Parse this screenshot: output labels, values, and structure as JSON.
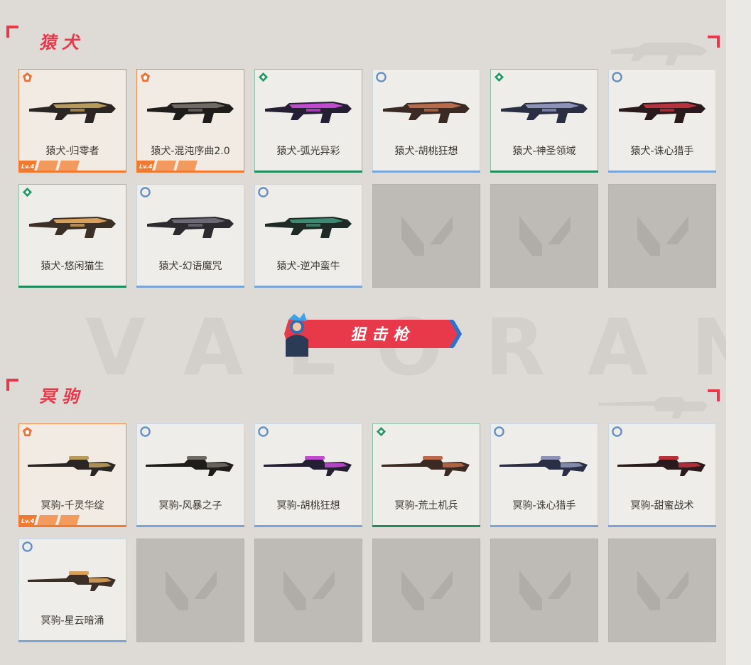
{
  "watermark": "VALORANT",
  "colors": {
    "accent": "#e8394a",
    "orange": "#f07a30",
    "green": "#1f8a5b",
    "blue": "#7aa4d6"
  },
  "sections": [
    {
      "title": "猿犬",
      "items": [
        {
          "name": "猿犬-归零者",
          "rarity": "exclusive",
          "badge": "pentagon-icon",
          "level": "Lv.4"
        },
        {
          "name": "猿犬-混沌序曲2.0",
          "rarity": "exclusive",
          "badge": "pentagon-icon",
          "level": "Lv.4"
        },
        {
          "name": "猿犬-弧光异彩",
          "rarity": "premium",
          "badge": "diamond-icon"
        },
        {
          "name": "猿犬-胡桃狂想",
          "rarity": "deluxe",
          "badge": "circle-icon"
        },
        {
          "name": "猿犬-神圣领域",
          "rarity": "premium",
          "badge": "diamond-icon"
        },
        {
          "name": "猿犬-诛心猎手",
          "rarity": "deluxe",
          "badge": "circle-icon"
        },
        {
          "name": "猿犬-悠闲猫生",
          "rarity": "premium",
          "badge": "diamond-icon"
        },
        {
          "name": "猿犬-幻语魔咒",
          "rarity": "deluxe",
          "badge": "circle-icon"
        },
        {
          "name": "猿犬-逆冲蛮牛",
          "rarity": "deluxe",
          "badge": "circle-icon"
        }
      ]
    },
    {
      "title": "冥驹",
      "items": [
        {
          "name": "冥驹-千灵华绽",
          "rarity": "exclusive",
          "badge": "pentagon-icon",
          "level": "Lv.4"
        },
        {
          "name": "冥驹-风暴之子",
          "rarity": "deluxe",
          "badge": "circle-icon"
        },
        {
          "name": "冥驹-胡桃狂想",
          "rarity": "deluxe",
          "badge": "circle-icon"
        },
        {
          "name": "冥驹-荒土机兵",
          "rarity": "premium",
          "badge": "diamond-icon"
        },
        {
          "name": "冥驹-诛心猎手",
          "rarity": "deluxe",
          "badge": "circle-icon"
        },
        {
          "name": "冥驹-甜蜜战术",
          "rarity": "deluxe",
          "badge": "circle-icon"
        },
        {
          "name": "冥驹-星云暗涌",
          "rarity": "deluxe",
          "badge": "circle-icon"
        }
      ]
    }
  ],
  "banner": {
    "label": "狙击枪"
  }
}
